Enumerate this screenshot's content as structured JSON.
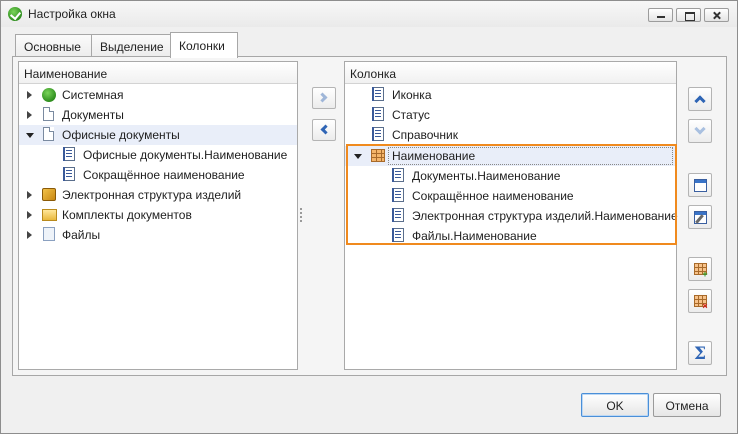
{
  "window": {
    "title": "Настройка окна"
  },
  "tabs": [
    {
      "label": "Основные"
    },
    {
      "label": "Выделение"
    },
    {
      "label": "Колонки",
      "active": true
    }
  ],
  "left_panel": {
    "header": "Наименование",
    "items": [
      {
        "label": "Системная",
        "icon": "system-icon",
        "expanded": false
      },
      {
        "label": "Документы",
        "icon": "document-icon",
        "expanded": false
      },
      {
        "label": "Офисные документы",
        "icon": "document-icon",
        "expanded": true,
        "selected": true,
        "children": [
          {
            "label": "Офисные документы.Наименование",
            "icon": "field-icon"
          },
          {
            "label": "Сокращённое наименование",
            "icon": "field-icon"
          }
        ]
      },
      {
        "label": "Электронная структура изделий",
        "icon": "box-icon",
        "expanded": false
      },
      {
        "label": "Комплекты документов",
        "icon": "folder-icon",
        "expanded": false
      },
      {
        "label": "Файлы",
        "icon": "file-icon",
        "expanded": false
      }
    ]
  },
  "right_panel": {
    "header": "Колонка",
    "items": [
      {
        "label": "Иконка",
        "icon": "field-icon"
      },
      {
        "label": "Статус",
        "icon": "field-icon"
      },
      {
        "label": "Справочник",
        "icon": "field-icon"
      },
      {
        "label": "Наименование",
        "icon": "composite-column-icon",
        "expanded": true,
        "focused": true,
        "children": [
          {
            "label": "Документы.Наименование",
            "icon": "field-icon"
          },
          {
            "label": "Сокращённое наименование",
            "icon": "field-icon"
          },
          {
            "label": "Электронная структура изделий.Наименование",
            "icon": "field-icon"
          },
          {
            "label": "Файлы.Наименование",
            "icon": "field-icon"
          }
        ]
      }
    ]
  },
  "middle_buttons": [
    {
      "name": "add-column-button",
      "icon": "chevron-right-icon",
      "enabled": false
    },
    {
      "name": "remove-column-button",
      "icon": "chevron-left-icon",
      "enabled": true
    }
  ],
  "tool_buttons": [
    {
      "name": "move-up-button",
      "icon": "chevron-up-icon",
      "enabled": true
    },
    {
      "name": "move-down-button",
      "icon": "chevron-down-icon",
      "enabled": false
    },
    {
      "name": "column-settings-button",
      "icon": "window-settings-icon"
    },
    {
      "name": "edit-column-button",
      "icon": "edit-icon"
    },
    {
      "name": "add-group-column-button",
      "icon": "table-add-icon"
    },
    {
      "name": "delete-group-column-button",
      "icon": "table-delete-icon"
    },
    {
      "name": "totals-button",
      "icon": "sigma-icon"
    }
  ],
  "footer": {
    "ok_label": "OK",
    "cancel_label": "Отмена"
  },
  "colors": {
    "highlight": "#f08a1e",
    "accent": "#2f65b5",
    "selection": "#e9eef9"
  }
}
